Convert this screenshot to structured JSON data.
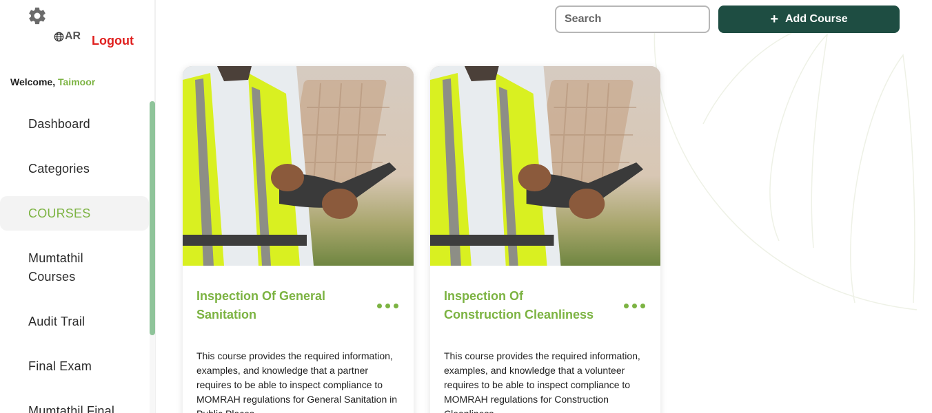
{
  "header": {
    "lang_label": "AR",
    "logout_label": "Logout",
    "welcome_prefix": "Welcome,",
    "user_name": "Taimoor",
    "search_placeholder": "Search",
    "add_course_label": "Add Course"
  },
  "sidebar": {
    "items": [
      {
        "label": "Dashboard"
      },
      {
        "label": "Categories"
      },
      {
        "label": "COURSES",
        "active": true
      },
      {
        "label": "Mumtathil Courses"
      },
      {
        "label": "Audit Trail"
      },
      {
        "label": "Final Exam"
      },
      {
        "label": "Mumtathil Final"
      }
    ]
  },
  "courses": [
    {
      "title": "Inspection Of General Sanitation",
      "description": "This course provides the required information, examples, and knowledge that a partner requires to be able to inspect compliance to MOMRAH regulations for General Sanitation in Public Places"
    },
    {
      "title": "Inspection Of Construction Cleanliness",
      "description": "This course provides the required information, examples, and knowledge that a volunteer requires to be able to inspect compliance to MOMRAH regulations for Construction Cleanliness"
    }
  ],
  "icons": {
    "settings": "gear-icon",
    "language": "globe-icon",
    "add": "plus-icon",
    "more": "more-dots-icon"
  },
  "colors": {
    "accent_green": "#7cb342",
    "dark_green": "#1e4d42",
    "logout_red": "#e0201f",
    "scroll_thumb": "#8fc49a"
  }
}
